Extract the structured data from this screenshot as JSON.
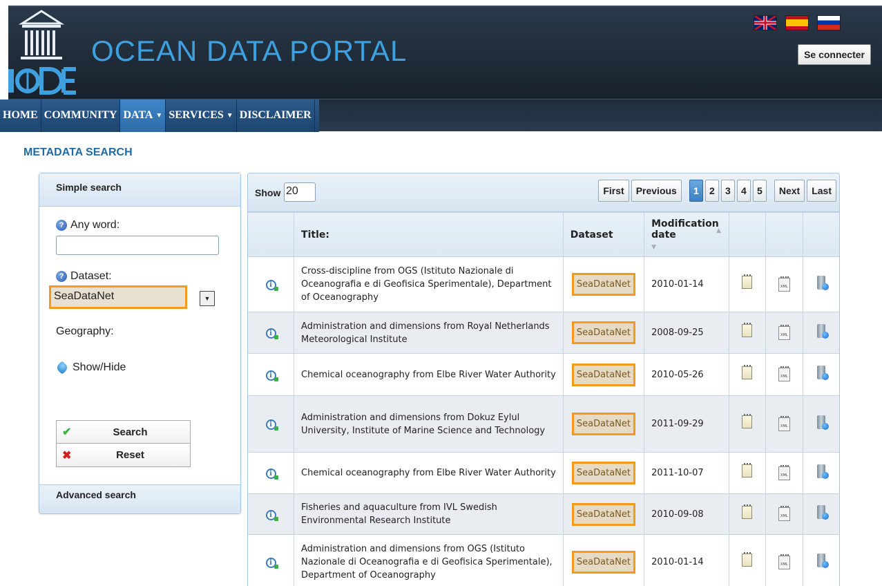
{
  "header": {
    "logo_text": "UNESCO IODE",
    "title": "OCEAN DATA PORTAL",
    "connect_label": "Se connecter",
    "flags": [
      "flag-uk",
      "flag-es",
      "flag-ru"
    ]
  },
  "nav": {
    "items": [
      {
        "label": "HOME",
        "dropdown": false
      },
      {
        "label": "COMMUNITY",
        "dropdown": false
      },
      {
        "label": "DATA",
        "dropdown": true,
        "active": true
      },
      {
        "label": "SERVICES",
        "dropdown": true
      },
      {
        "label": "DISCLAIMER",
        "dropdown": false
      }
    ]
  },
  "page": {
    "title": "METADATA SEARCH"
  },
  "sidebar": {
    "heading": "Simple search",
    "any_word_label": "Any word:",
    "any_word_value": "",
    "dataset_label": "Dataset:",
    "dataset_value": "SeaDataNet",
    "geography_label": "Geography:",
    "show_hide_label": "Show/Hide",
    "search_label": "Search",
    "reset_label": "Reset",
    "advanced_label": "Advanced search"
  },
  "results": {
    "show_label": "Show",
    "show_value": "20",
    "pager": {
      "first": "First",
      "previous": "Previous",
      "pages": [
        "1",
        "2",
        "3",
        "4",
        "5"
      ],
      "current": "1",
      "next": "Next",
      "last": "Last"
    },
    "columns": {
      "title": "Title:",
      "dataset": "Dataset",
      "date": "Modification date"
    },
    "rows": [
      {
        "title": "Cross-discipline from OGS (Istituto Nazionale di Oceanografia e di Geofisica Sperimentale), Department of Oceanography",
        "dataset": "SeaDataNet",
        "date": "2010-01-14"
      },
      {
        "title": "Administration and dimensions from Royal Netherlands Meteorological Institute",
        "dataset": "SeaDataNet",
        "date": "2008-09-25"
      },
      {
        "title": "Chemical oceanography from Elbe River Water Authority",
        "dataset": "SeaDataNet",
        "date": "2010-05-26"
      },
      {
        "title": "Administration and dimensions from Dokuz Eylul University, Institute of Marine Science and Technology",
        "dataset": "SeaDataNet",
        "date": "2011-09-29"
      },
      {
        "title": "Chemical oceanography from Elbe River Water Authority",
        "dataset": "SeaDataNet",
        "date": "2011-10-07"
      },
      {
        "title": "Fisheries and aquaculture from IVL Swedish Environmental Research Institute",
        "dataset": "SeaDataNet",
        "date": "2010-09-08"
      },
      {
        "title": "Administration and dimensions from OGS (Istituto Nazionale di Oceanografia e di Geofisica Sperimentale), Department of Oceanography",
        "dataset": "SeaDataNet",
        "date": "2010-01-14"
      }
    ]
  },
  "colors": {
    "accent_orange": "#f39a1d",
    "title_blue": "#3fa0e0",
    "nav_active": "#3f86c8"
  }
}
